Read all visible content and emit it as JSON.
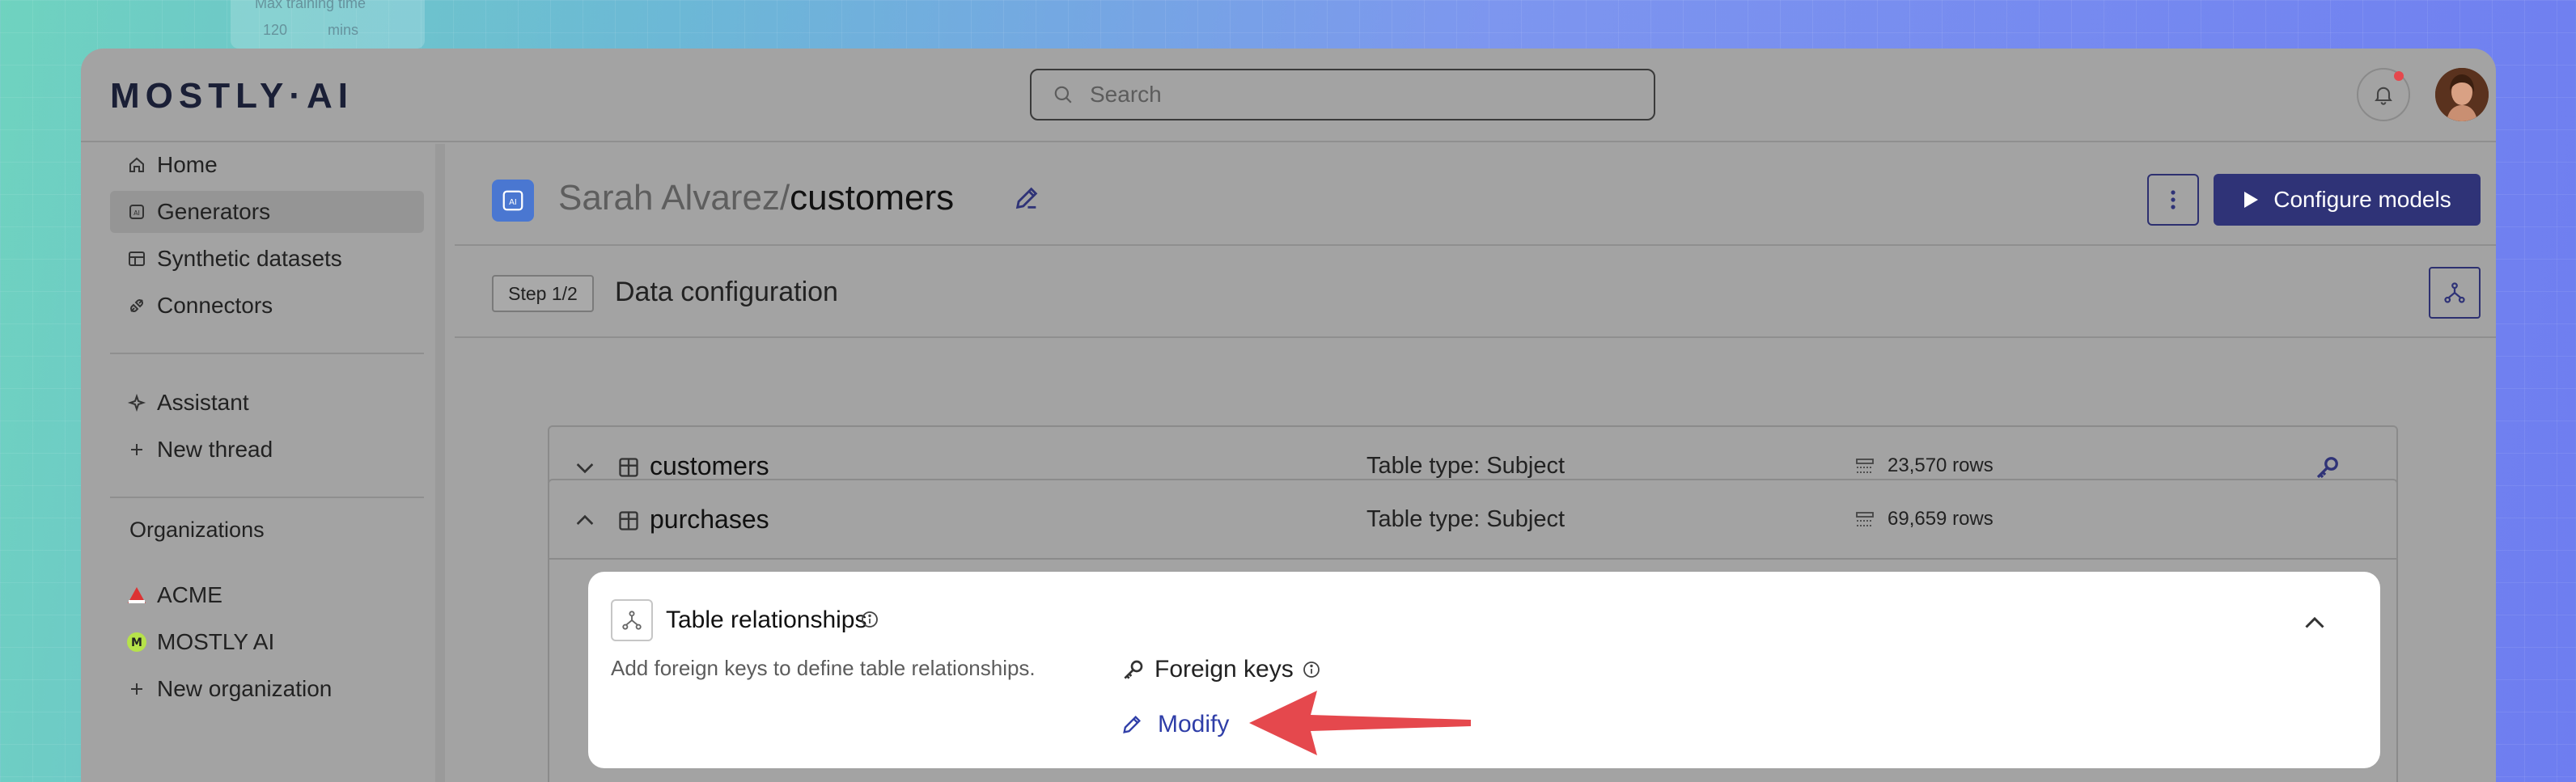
{
  "background_card": {
    "title": "Max training time",
    "value": "120",
    "unit": "mins"
  },
  "app": {
    "logo": "MOSTLY·AI"
  },
  "search": {
    "placeholder": "Search"
  },
  "sidebar": {
    "items": [
      {
        "label": "Home",
        "icon": "home-icon"
      },
      {
        "label": "Generators",
        "icon": "generator-icon",
        "active": true
      },
      {
        "label": "Synthetic datasets",
        "icon": "dataset-icon"
      },
      {
        "label": "Connectors",
        "icon": "plug-icon"
      }
    ],
    "assistant_items": [
      {
        "label": "Assistant",
        "icon": "sparkle-icon"
      },
      {
        "label": "New thread",
        "icon": "plus-icon"
      }
    ],
    "organizations_title": "Organizations",
    "organizations": [
      {
        "label": "ACME",
        "icon": "acme-logo-icon"
      },
      {
        "label": "MOSTLY AI",
        "icon": "mostly-ai-badge-icon"
      },
      {
        "label": "New organization",
        "icon": "plus-icon"
      }
    ]
  },
  "header": {
    "owner": "Sarah Alvarez",
    "separator": "/",
    "generator_name": "customers",
    "configure_label": "Configure models"
  },
  "step": {
    "badge": "Step 1/2",
    "title": "Data configuration"
  },
  "tables": [
    {
      "name": "customers",
      "type": "Table type: Subject",
      "rows": "23,570 rows",
      "expanded": false
    },
    {
      "name": "purchases",
      "type": "Table type: Subject",
      "rows": "69,659 rows",
      "expanded": true
    }
  ],
  "relationships": {
    "title": "Table relationships",
    "description": "Add foreign keys to define table relationships.",
    "foreign_keys_label": "Foreign keys",
    "modify_label": "Modify"
  },
  "colors": {
    "primary": "#2f3377",
    "accent": "#4a77d1",
    "link": "#2f3ea8",
    "arrow": "#e5484d"
  }
}
